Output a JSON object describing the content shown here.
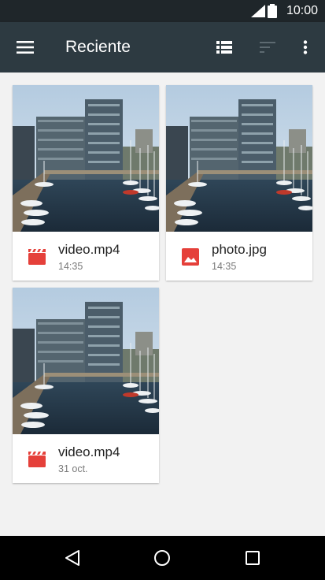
{
  "status_bar": {
    "time": "10:00",
    "icons": [
      "signal-icon",
      "battery-icon"
    ]
  },
  "app_bar": {
    "title": "Reciente",
    "icons": [
      "menu-icon",
      "list-view-icon",
      "sort-icon",
      "more-vert-icon"
    ]
  },
  "files": [
    {
      "name": "video.mp4",
      "date": "14:35",
      "type_icon": "video-icon"
    },
    {
      "name": "photo.jpg",
      "date": "14:35",
      "type_icon": "image-icon"
    },
    {
      "name": "video.mp4",
      "date": "31 oct.",
      "type_icon": "video-icon"
    }
  ],
  "nav_bar": {
    "icons": [
      "back-icon",
      "home-icon",
      "recents-icon"
    ]
  },
  "colors": {
    "status_bar": "#1f262a",
    "app_bar": "#2d3a41",
    "background": "#f2f2f2",
    "file_type_icon": "#e5403a"
  }
}
